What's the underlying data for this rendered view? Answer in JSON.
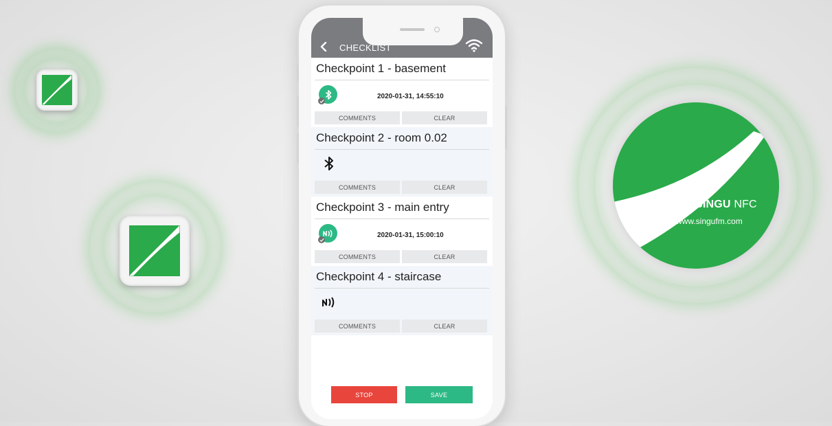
{
  "header": {
    "title": "CHECKLIST",
    "back_icon": "chevron-left-icon",
    "status_icon": "wifi-icon"
  },
  "checkpoints": [
    {
      "title": "Checkpoint 1 - basement",
      "status_icon": "bluetooth-icon",
      "completed": true,
      "timestamp": "2020-01-31, 14:55:10",
      "comments_label": "COMMENTS",
      "clear_label": "CLEAR"
    },
    {
      "title": "Checkpoint 2 - room 0.02",
      "status_icon": "bluetooth-icon",
      "completed": false,
      "timestamp": "",
      "comments_label": "COMMENTS",
      "clear_label": "CLEAR"
    },
    {
      "title": "Checkpoint 3 - main entry",
      "status_icon": "nfc-icon",
      "completed": true,
      "timestamp": "2020-01-31, 15:00:10",
      "comments_label": "COMMENTS",
      "clear_label": "CLEAR"
    },
    {
      "title": "Checkpoint 4 - staircase",
      "status_icon": "nfc-icon",
      "completed": false,
      "timestamp": "",
      "comments_label": "COMMENTS",
      "clear_label": "CLEAR"
    }
  ],
  "footer": {
    "stop_label": "STOP",
    "save_label": "SAVE"
  },
  "nfc_tag": {
    "brand_bold": "SINGU",
    "brand_light": " NFC",
    "url": "www.singufm.com"
  },
  "colors": {
    "brand_green": "#2aaa4a",
    "completed_green": "#2db985",
    "stop_red": "#e8453c",
    "header_gray": "#7a7c80"
  }
}
